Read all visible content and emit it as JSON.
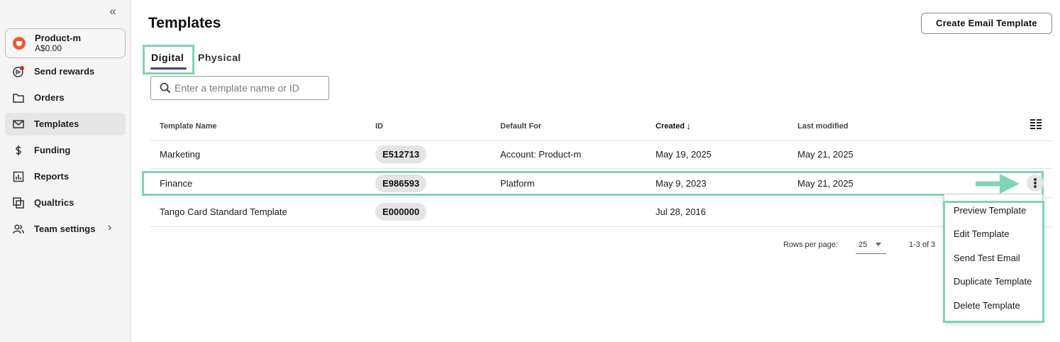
{
  "sidebar": {
    "account": {
      "name": "Product-m",
      "balance": "A$0.00"
    },
    "items": [
      {
        "label": "Send rewards",
        "icon": "send-rewards-icon"
      },
      {
        "label": "Orders",
        "icon": "folder-icon"
      },
      {
        "label": "Templates",
        "icon": "mail-icon",
        "active": true
      },
      {
        "label": "Funding",
        "icon": "dollar-icon"
      },
      {
        "label": "Reports",
        "icon": "chart-icon"
      },
      {
        "label": "Qualtrics",
        "icon": "qualtrics-icon"
      },
      {
        "label": "Team settings",
        "icon": "people-icon"
      }
    ],
    "collapse_glyph": "«"
  },
  "page": {
    "title": "Templates",
    "create_button": "Create Email Template"
  },
  "tabs": [
    {
      "label": "Digital",
      "selected": true
    },
    {
      "label": "Physical",
      "selected": false
    }
  ],
  "search": {
    "placeholder": "Enter a template name or ID",
    "value": ""
  },
  "table": {
    "columns": [
      "Template Name",
      "ID",
      "Default For",
      "Created",
      "Last modified"
    ],
    "sort": {
      "column": "Created",
      "direction": "descending",
      "glyph": "↓"
    },
    "rows": [
      {
        "name": "Marketing",
        "id": "E512713",
        "default_for": "Account: Product-m",
        "created": "May 19, 2025",
        "modified": "May 21, 2025"
      },
      {
        "name": "Finance",
        "id": "E986593",
        "default_for": "Platform",
        "created": "May 9, 2023",
        "modified": "May 21, 2025"
      },
      {
        "name": "Tango Card Standard Template",
        "id": "E000000",
        "default_for": "",
        "created": "Jul 28, 2016",
        "modified": ""
      }
    ]
  },
  "pagination": {
    "rows_per_page_label": "Rows per page:",
    "rows_per_page_value": "25",
    "range": "1-3 of 3"
  },
  "row_menu": {
    "items": [
      "Preview Template",
      "Edit Template",
      "Send Test Email",
      "Duplicate Template",
      "Delete Template"
    ]
  },
  "colors": {
    "accent": "#4b3d8f",
    "highlight": "#7fd3b6",
    "brand": "#f0592a"
  }
}
